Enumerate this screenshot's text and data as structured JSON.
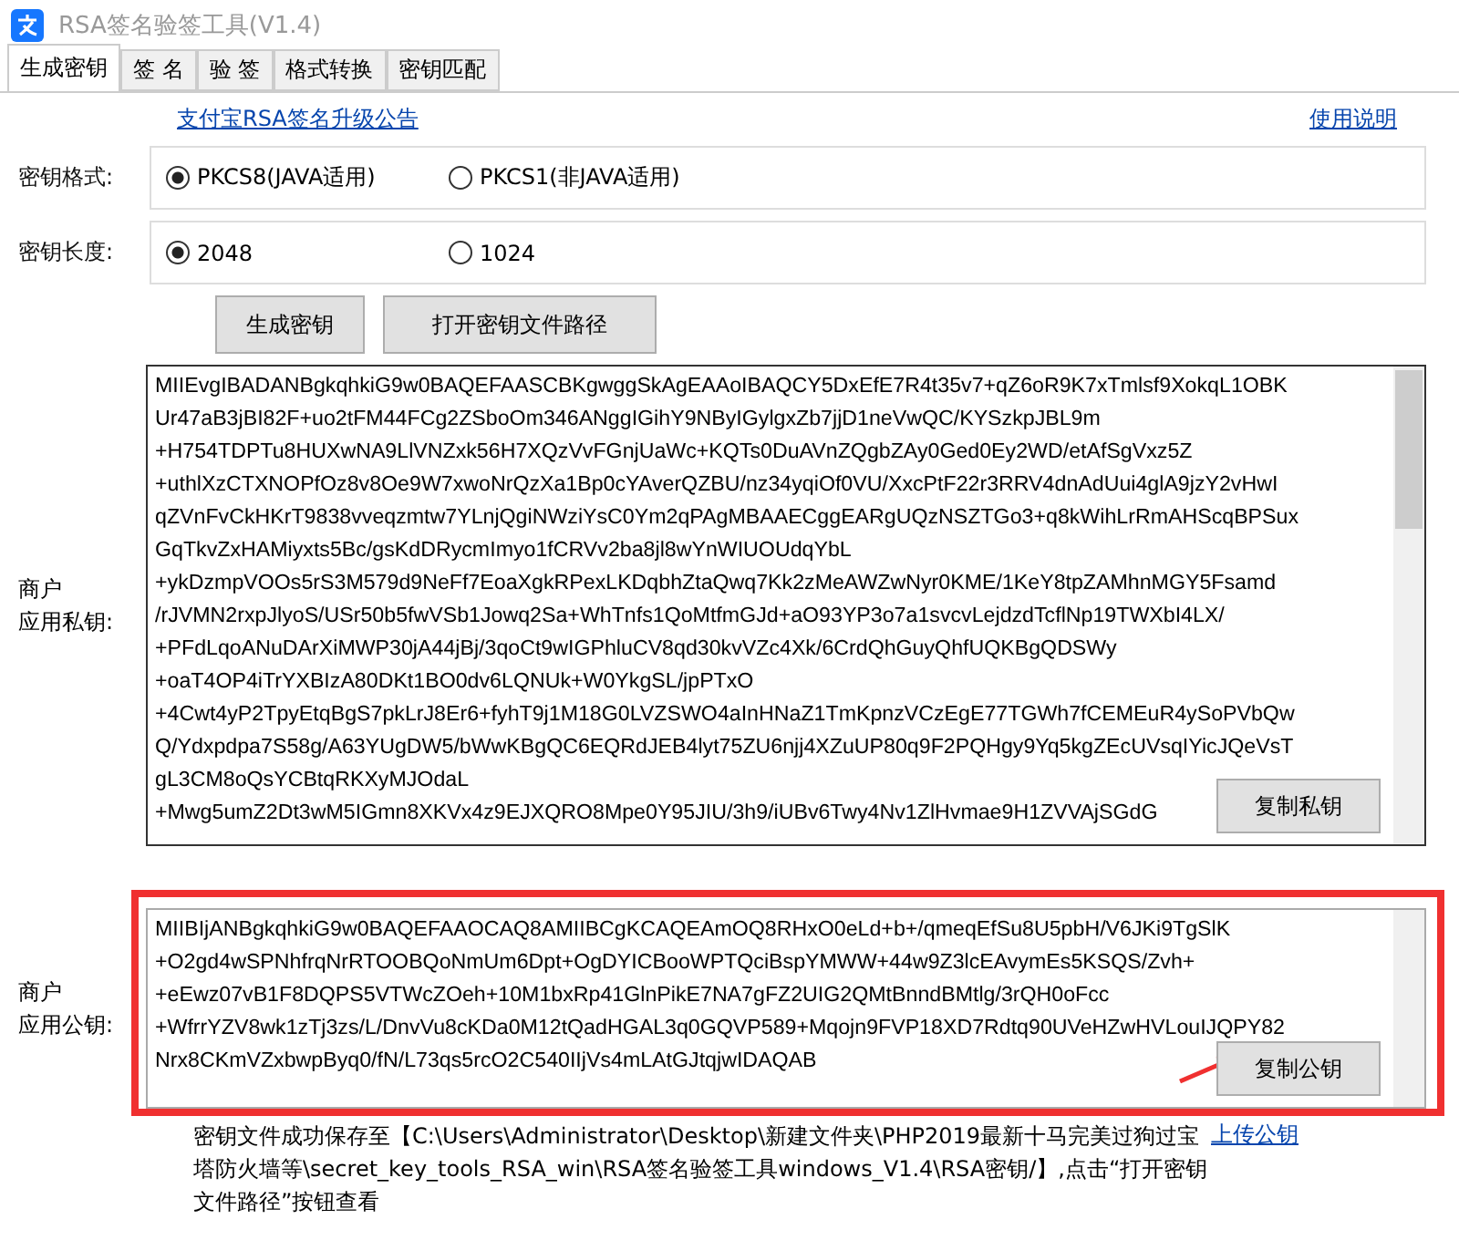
{
  "window": {
    "title": "RSA签名验签工具(V1.4)"
  },
  "tabs": [
    {
      "label": "生成密钥",
      "selected": true
    },
    {
      "label": "签 名",
      "selected": false
    },
    {
      "label": "验 签",
      "selected": false
    },
    {
      "label": "格式转换",
      "selected": false
    },
    {
      "label": "密钥匹配",
      "selected": false
    }
  ],
  "notice_link": "支付宝RSA签名升级公告",
  "help_link": "使用说明",
  "key_format": {
    "label": "密钥格式:",
    "options": [
      {
        "label": "PKCS8(JAVA适用)",
        "selected": true
      },
      {
        "label": "PKCS1(非JAVA适用)",
        "selected": false
      }
    ]
  },
  "key_length": {
    "label": "密钥长度:",
    "options": [
      {
        "label": "2048",
        "selected": true
      },
      {
        "label": "1024",
        "selected": false
      }
    ]
  },
  "buttons": [
    "生成密钥",
    "打开密钥文件路径"
  ],
  "private_key": {
    "label_lines": [
      "商户",
      "应用私钥:"
    ],
    "button": "复制私钥",
    "lines": [
      "MIIEvgIBADANBgkqhkiG9w0BAQEFAASCBKgwggSkAgEAAoIBAQCY5DxEfE7R4t35v7+qZ6oR9K7xTmlsf9XokqL1OBK",
      "Ur47aB3jBI82F+uo2tFM44FCg2ZSboOm346ANggIGihY9NByIGylgxZb7jjD1neVwQC/KYSzkpJBL9m",
      "+H754TDPTu8HUXwNA9LlVNZxk56H7XQzVvFGnjUaWc+KQTs0DuAVnZQgbZAy0Ged0Ey2WD/etAfSgVxz5Z",
      "+uthlXzCTXNOPfOz8v8Oe9W7xwoNrQzXa1Bp0cYAverQZBU/nz34yqiOf0VU/XxcPtF22r3RRV4dnAdUui4glA9jzY2vHwI",
      "qZVnFvCkHKrT9838vveqzmtw7YLnjQgiNWziYsC0Ym2qPAgMBAAECggEARgUQzNSZTGo3+q8kWihLrRmAHScqBPSux",
      "GqTkvZxHAMiyxts5Bc/gsKdDRycmImyo1fCRVv2ba8jl8wYnWIUOUdqYbL",
      "+ykDzmpVOOs5rS3M579d9NeFf7EoaXgkRPexLKDqbhZtaQwq7Kk2zMeAWZwNyr0KME/1KeY8tpZAMhnMGY5Fsamd",
      "/rJVMN2rxpJlyoS/USr50b5fwVSb1Jowq2Sa+WhTnfs1QoMtfmGJd+aO93YP3o7a1svcvLejdzdTcflNp19TWXbI4LX/",
      "+PFdLqoANuDArXiMWP30jA44jBj/3qoCt9wIGPhluCV8qd30kvVZc4Xk/6CrdQhGuyQhfUQKBgQDSWy",
      "+oaT4OP4iTrYXBIzA80DKt1BO0dv6LQNUk+W0YkgSL/jpPTxO",
      "+4Cwt4yP2TpyEtqBgS7pkLrJ8Er6+fyhT9j1M18G0LVZSWO4aInHNaZ1TmKpnzVCzEgE77TGWh7fCEMEuR4ySoPVbQw",
      "Q/Ydxpdpa7S58g/A63YUgDW5/bWwKBgQC6EQRdJEB4lyt75ZU6njj4XZuUP80q9F2PQHgy9Yq5kgZEcUVsqIYicJQeVsT",
      "gL3CM8oQsYCBtqRKXyMJOdaL",
      "+Mwg5umZ2Dt3wM5IGmn8XKVx4z9EJXQRO8Mpe0Y95JIU/3h9/iUBv6Twy4Nv1ZlHvmae9H1ZVVAjSGdG"
    ]
  },
  "public_key": {
    "label_lines": [
      "商户",
      "应用公钥:"
    ],
    "button": "复制公钥",
    "lines": [
      "MIIBIjANBgkqhkiG9w0BAQEFAAOCAQ8AMIIBCgKCAQEAmOQ8RHxO0eLd+b+/qmeqEfSu8U5pbH/V6JKi9TgSlK",
      "+O2gd4wSPNhfrqNrRTOOBQoNmUm6Dpt+OgDYICBooWPTQciBspYMWW+44w9Z3lcEAvymEs5KSQS/Zvh+",
      "+eEwz07vB1F8DQPS5VTWcZOeh+10M1bxRp41GlnPikE7NA7gFZ2UIG2QMtBnndBMtlg/3rQH0oFcc",
      "+WfrrYZV8wk1zTj3zs/L/DnvVu8cKDa0M12tQadHGAL3q0GQVP589+Mqojn9FVP18XD7Rdtq90UVeHZwHVLouIJQPY82",
      "Nrx8CKmVZxbwpByq0/fN/L73qs5rcO2C540IIjVs4mLAtGJtqjwIDAQAB"
    ]
  },
  "message_lines": [
    "密钥文件成功保存至【C:\\Users\\Administrator\\Desktop\\新建文件夹\\PHP2019最新十马完美过狗过宝",
    "塔防火墙等\\secret_key_tools_RSA_win\\RSA签名验签工具windows_V1.4\\RSA密钥/】,点击“打开密钥",
    "文件路径”按钮查看"
  ],
  "upload_link": "上传公钥"
}
